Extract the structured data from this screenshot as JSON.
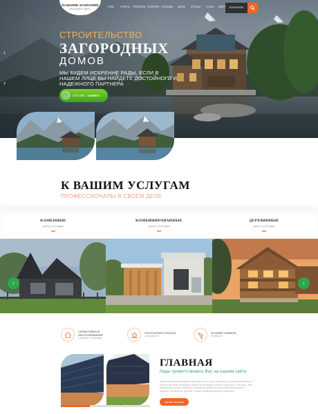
{
  "colors": {
    "accent_orange": "#f26522",
    "heading_gold": "#f1b15a",
    "green_button": "#4aa81f",
    "subtitle_peach": "#f0a07a",
    "about_green": "#2ea36a",
    "dark": "#111111"
  },
  "header": {
    "logo_title": "НАЗВАНИЕ КОМПАНИИ",
    "logo_sub": "ВАШ ДЕВИЗ ЗДЕСЬ",
    "nav": [
      "ГЛАВ",
      "УСЛУГИ",
      "ПРОЕКТЫ",
      "ГАЛЕРЕЯ",
      "ОТЗЫВЫ",
      "ЦЕНЫ",
      "СТАТЬИ",
      "О НАС",
      "ВОПРОС"
    ],
    "contacts_label": "КОНТАКТЫ",
    "search_icon": "search-icon"
  },
  "hero": {
    "line1": "СТРОИТЕЛЬСТВО",
    "line2": "ЗАГОРОДНЫХ",
    "line3": "ДОМОВ",
    "description": "МЫ БУДЕМ ИСКРЕННЕ РАДЫ, ЕСЛИ В НАШЕМ ЛИЦЕ ВЫ НАЙДЕТЕ ДОСТОЙНОГО И НАДЕЖНОГО ПАРТНЕРА",
    "button_prefix": "ON-LINE",
    "button_label": "ЗАЯВКА",
    "button_icon": "chat-icon",
    "arrow_prev": "‹",
    "arrow_next": "›"
  },
  "services": {
    "title": "К ВАШИМ УСЛУГАМ",
    "subtitle": "ПРОФЕССИОНАЛЫ В СВОЕМ ДЕЛЕ",
    "categories": [
      {
        "name": "КАМЕННЫЕ",
        "sub": "дома и коттеджи"
      },
      {
        "name": "КОМБИНИРОВАННЫЕ",
        "sub": "дома и коттеджи"
      },
      {
        "name": "ДЕРЕВЯННЫЕ",
        "sub": "дома и коттеджи"
      }
    ],
    "prev_arrow": "‹",
    "next_arrow": "›"
  },
  "features": [
    {
      "title1": "ГАРАНТИЙНОЕ",
      "title2": "ОБСЛУЖИВАНИЕ",
      "sub": "в течение 15 месяцев",
      "icon": "house-icon"
    },
    {
      "title1": "ПОЭТАПНАЯ ОПЛАТА",
      "title2": "",
      "sub": "с рассрочкой",
      "icon": "house-hand-icon"
    },
    {
      "title1": "ОНЛАЙН КАМЕРА",
      "title2": "",
      "sub": "на объекте",
      "icon": "camera-icon"
    }
  ],
  "about": {
    "title": "ГЛАВНАЯ",
    "subtitle": "Рады приветствовать Вас на нашем сайте",
    "text": "Наша компания оказывает широкий спектр услуг, связанных с проектированием и строительством загородных домов и коттеджей любой сложности и под ключ. Мы предлагаем своим клиентам сооружение домов из различных материалов — кирпича, газобетона, дерева, а также комбинированные решения.",
    "button_label": "Узнать больше",
    "progress": [
      1,
      0,
      0
    ]
  }
}
